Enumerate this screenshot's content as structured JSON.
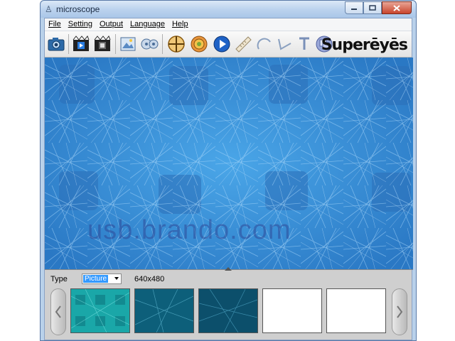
{
  "window": {
    "title": "microscope"
  },
  "menu": [
    "File",
    "Setting",
    "Output",
    "Language",
    "Help"
  ],
  "toolbar": {
    "brand": "Superēyēs",
    "buttons": [
      "camera-icon",
      "video-record-icon",
      "video-stop-icon",
      "photo-album-icon",
      "video-album-icon",
      "crosshair-icon",
      "settings-gear-icon",
      "play-icon",
      "ruler-icon",
      "arc-tool-icon",
      "angle-tool-icon",
      "text-tool-icon",
      "overlay-icon"
    ]
  },
  "viewer": {
    "watermark": "usb.brando.com"
  },
  "capture": {
    "type_label": "Type",
    "type_value": "Picture",
    "resolution": "640x480"
  },
  "thumbnails": [
    {
      "state": "filled",
      "tone": "#1aa7a8"
    },
    {
      "state": "filled",
      "tone": "#0d5f7a"
    },
    {
      "state": "filled",
      "tone": "#0c4f6b"
    },
    {
      "state": "empty"
    },
    {
      "state": "empty"
    }
  ],
  "colors": {
    "viewer_blue": "#3a90d4",
    "title_bar": "#bcd3ee",
    "thumb_border": "#555555"
  }
}
